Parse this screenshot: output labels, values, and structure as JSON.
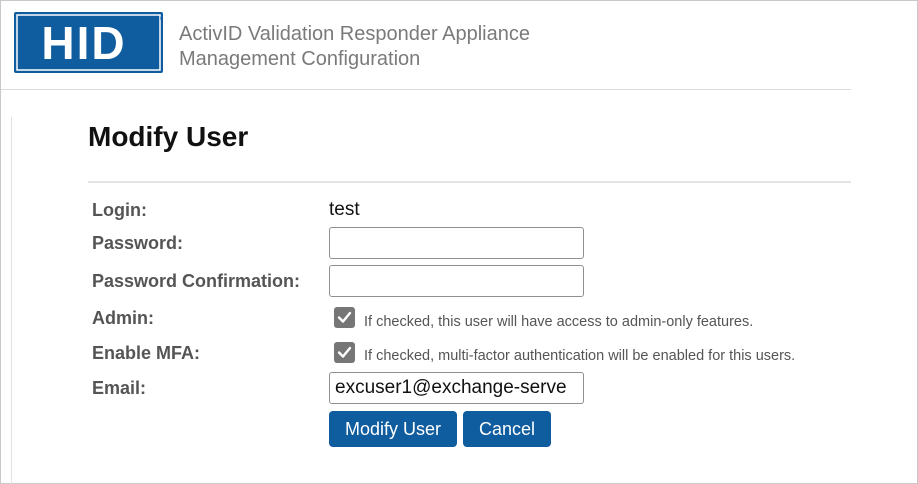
{
  "brand": {
    "logo_text": "HID",
    "logo_color": "#0f5c9e"
  },
  "header": {
    "line1": "ActivID Validation Responder Appliance",
    "line2": "Management Configuration"
  },
  "page": {
    "title": "Modify User"
  },
  "form": {
    "login_label": "Login:",
    "login_value": "test",
    "password_label": "Password:",
    "password_value": "",
    "password_confirm_label": "Password Confirmation:",
    "password_confirm_value": "",
    "admin_label": "Admin:",
    "admin_checked": true,
    "admin_hint": "If checked, this user will have access to admin-only features.",
    "mfa_label": "Enable MFA:",
    "mfa_checked": true,
    "mfa_hint": "If checked, multi-factor authentication will be enabled for this users.",
    "email_label": "Email:",
    "email_value": "excuser1@exchange-serve"
  },
  "buttons": {
    "submit_label": "Modify User",
    "cancel_label": "Cancel"
  },
  "colors": {
    "button_bg": "#0f5c9e",
    "checkbox_bg": "#767676"
  }
}
